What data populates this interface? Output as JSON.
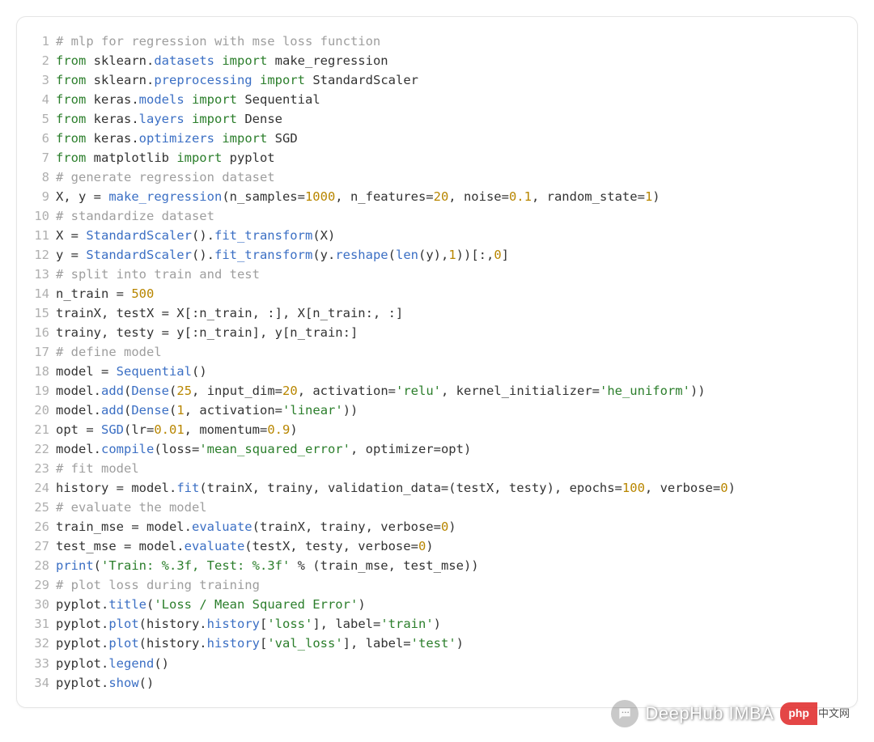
{
  "watermark": {
    "brand": "DeepHub IMBA",
    "badge_left": "php",
    "badge_right": "中文网"
  },
  "code": {
    "lines": [
      [
        {
          "t": "# mlp for regression with mse loss function",
          "c": "comment"
        }
      ],
      [
        {
          "t": "from",
          "c": "keyword"
        },
        {
          "t": " sklearn",
          "c": "ident"
        },
        {
          "t": ".",
          "c": "punct"
        },
        {
          "t": "datasets",
          "c": "func"
        },
        {
          "t": " ",
          "c": "ident"
        },
        {
          "t": "import",
          "c": "keyword"
        },
        {
          "t": " make_regression",
          "c": "ident"
        }
      ],
      [
        {
          "t": "from",
          "c": "keyword"
        },
        {
          "t": " sklearn",
          "c": "ident"
        },
        {
          "t": ".",
          "c": "punct"
        },
        {
          "t": "preprocessing",
          "c": "func"
        },
        {
          "t": " ",
          "c": "ident"
        },
        {
          "t": "import",
          "c": "keyword"
        },
        {
          "t": " StandardScaler",
          "c": "ident"
        }
      ],
      [
        {
          "t": "from",
          "c": "keyword"
        },
        {
          "t": " keras",
          "c": "ident"
        },
        {
          "t": ".",
          "c": "punct"
        },
        {
          "t": "models",
          "c": "func"
        },
        {
          "t": " ",
          "c": "ident"
        },
        {
          "t": "import",
          "c": "keyword"
        },
        {
          "t": " Sequential",
          "c": "ident"
        }
      ],
      [
        {
          "t": "from",
          "c": "keyword"
        },
        {
          "t": " keras",
          "c": "ident"
        },
        {
          "t": ".",
          "c": "punct"
        },
        {
          "t": "layers",
          "c": "func"
        },
        {
          "t": " ",
          "c": "ident"
        },
        {
          "t": "import",
          "c": "keyword"
        },
        {
          "t": " Dense",
          "c": "ident"
        }
      ],
      [
        {
          "t": "from",
          "c": "keyword"
        },
        {
          "t": " keras",
          "c": "ident"
        },
        {
          "t": ".",
          "c": "punct"
        },
        {
          "t": "optimizers",
          "c": "func"
        },
        {
          "t": " ",
          "c": "ident"
        },
        {
          "t": "import",
          "c": "keyword"
        },
        {
          "t": " SGD",
          "c": "ident"
        }
      ],
      [
        {
          "t": "from",
          "c": "keyword"
        },
        {
          "t": " matplotlib ",
          "c": "ident"
        },
        {
          "t": "import",
          "c": "keyword"
        },
        {
          "t": " pyplot",
          "c": "ident"
        }
      ],
      [
        {
          "t": "# generate regression dataset",
          "c": "comment"
        }
      ],
      [
        {
          "t": "X, y = ",
          "c": "ident"
        },
        {
          "t": "make_regression",
          "c": "func"
        },
        {
          "t": "(n_samples=",
          "c": "ident"
        },
        {
          "t": "1000",
          "c": "number"
        },
        {
          "t": ", n_features=",
          "c": "ident"
        },
        {
          "t": "20",
          "c": "number"
        },
        {
          "t": ", noise=",
          "c": "ident"
        },
        {
          "t": "0.1",
          "c": "number"
        },
        {
          "t": ", random_state=",
          "c": "ident"
        },
        {
          "t": "1",
          "c": "number"
        },
        {
          "t": ")",
          "c": "ident"
        }
      ],
      [
        {
          "t": "# standardize dataset",
          "c": "comment"
        }
      ],
      [
        {
          "t": "X = ",
          "c": "ident"
        },
        {
          "t": "StandardScaler",
          "c": "func"
        },
        {
          "t": "().",
          "c": "ident"
        },
        {
          "t": "fit_transform",
          "c": "func"
        },
        {
          "t": "(X)",
          "c": "ident"
        }
      ],
      [
        {
          "t": "y = ",
          "c": "ident"
        },
        {
          "t": "StandardScaler",
          "c": "func"
        },
        {
          "t": "().",
          "c": "ident"
        },
        {
          "t": "fit_transform",
          "c": "func"
        },
        {
          "t": "(y.",
          "c": "ident"
        },
        {
          "t": "reshape",
          "c": "func"
        },
        {
          "t": "(",
          "c": "ident"
        },
        {
          "t": "len",
          "c": "func"
        },
        {
          "t": "(y),",
          "c": "ident"
        },
        {
          "t": "1",
          "c": "number"
        },
        {
          "t": "))[:,",
          "c": "ident"
        },
        {
          "t": "0",
          "c": "number"
        },
        {
          "t": "]",
          "c": "ident"
        }
      ],
      [
        {
          "t": "# split into train and test",
          "c": "comment"
        }
      ],
      [
        {
          "t": "n_train = ",
          "c": "ident"
        },
        {
          "t": "500",
          "c": "number"
        }
      ],
      [
        {
          "t": "trainX, testX = X[:n_train, :], X[n_train:, :]",
          "c": "ident"
        }
      ],
      [
        {
          "t": "trainy, testy = y[:n_train], y[n_train:]",
          "c": "ident"
        }
      ],
      [
        {
          "t": "# define model",
          "c": "comment"
        }
      ],
      [
        {
          "t": "model = ",
          "c": "ident"
        },
        {
          "t": "Sequential",
          "c": "func"
        },
        {
          "t": "()",
          "c": "ident"
        }
      ],
      [
        {
          "t": "model.",
          "c": "ident"
        },
        {
          "t": "add",
          "c": "func"
        },
        {
          "t": "(",
          "c": "ident"
        },
        {
          "t": "Dense",
          "c": "func"
        },
        {
          "t": "(",
          "c": "ident"
        },
        {
          "t": "25",
          "c": "number"
        },
        {
          "t": ", input_dim=",
          "c": "ident"
        },
        {
          "t": "20",
          "c": "number"
        },
        {
          "t": ", activation=",
          "c": "ident"
        },
        {
          "t": "'relu'",
          "c": "string"
        },
        {
          "t": ", kernel_initializer=",
          "c": "ident"
        },
        {
          "t": "'he_uniform'",
          "c": "string"
        },
        {
          "t": "))",
          "c": "ident"
        }
      ],
      [
        {
          "t": "model.",
          "c": "ident"
        },
        {
          "t": "add",
          "c": "func"
        },
        {
          "t": "(",
          "c": "ident"
        },
        {
          "t": "Dense",
          "c": "func"
        },
        {
          "t": "(",
          "c": "ident"
        },
        {
          "t": "1",
          "c": "number"
        },
        {
          "t": ", activation=",
          "c": "ident"
        },
        {
          "t": "'linear'",
          "c": "string"
        },
        {
          "t": "))",
          "c": "ident"
        }
      ],
      [
        {
          "t": "opt = ",
          "c": "ident"
        },
        {
          "t": "SGD",
          "c": "func"
        },
        {
          "t": "(lr=",
          "c": "ident"
        },
        {
          "t": "0.01",
          "c": "number"
        },
        {
          "t": ", momentum=",
          "c": "ident"
        },
        {
          "t": "0.9",
          "c": "number"
        },
        {
          "t": ")",
          "c": "ident"
        }
      ],
      [
        {
          "t": "model.",
          "c": "ident"
        },
        {
          "t": "compile",
          "c": "func"
        },
        {
          "t": "(loss=",
          "c": "ident"
        },
        {
          "t": "'mean_squared_error'",
          "c": "string"
        },
        {
          "t": ", optimizer=opt)",
          "c": "ident"
        }
      ],
      [
        {
          "t": "# fit model",
          "c": "comment"
        }
      ],
      [
        {
          "t": "history = model.",
          "c": "ident"
        },
        {
          "t": "fit",
          "c": "func"
        },
        {
          "t": "(trainX, trainy, validation_data=(testX, testy), epochs=",
          "c": "ident"
        },
        {
          "t": "100",
          "c": "number"
        },
        {
          "t": ", verbose=",
          "c": "ident"
        },
        {
          "t": "0",
          "c": "number"
        },
        {
          "t": ")",
          "c": "ident"
        }
      ],
      [
        {
          "t": "# evaluate the model",
          "c": "comment"
        }
      ],
      [
        {
          "t": "train_mse = model.",
          "c": "ident"
        },
        {
          "t": "evaluate",
          "c": "func"
        },
        {
          "t": "(trainX, trainy, verbose=",
          "c": "ident"
        },
        {
          "t": "0",
          "c": "number"
        },
        {
          "t": ")",
          "c": "ident"
        }
      ],
      [
        {
          "t": "test_mse = model.",
          "c": "ident"
        },
        {
          "t": "evaluate",
          "c": "func"
        },
        {
          "t": "(testX, testy, verbose=",
          "c": "ident"
        },
        {
          "t": "0",
          "c": "number"
        },
        {
          "t": ")",
          "c": "ident"
        }
      ],
      [
        {
          "t": "print",
          "c": "func"
        },
        {
          "t": "(",
          "c": "ident"
        },
        {
          "t": "'Train: %.3f, Test: %.3f'",
          "c": "string"
        },
        {
          "t": " % (train_mse, test_mse))",
          "c": "ident"
        }
      ],
      [
        {
          "t": "# plot loss during training",
          "c": "comment"
        }
      ],
      [
        {
          "t": "pyplot.",
          "c": "ident"
        },
        {
          "t": "title",
          "c": "func"
        },
        {
          "t": "(",
          "c": "ident"
        },
        {
          "t": "'Loss / Mean Squared Error'",
          "c": "string"
        },
        {
          "t": ")",
          "c": "ident"
        }
      ],
      [
        {
          "t": "pyplot.",
          "c": "ident"
        },
        {
          "t": "plot",
          "c": "func"
        },
        {
          "t": "(history.",
          "c": "ident"
        },
        {
          "t": "history",
          "c": "func"
        },
        {
          "t": "[",
          "c": "ident"
        },
        {
          "t": "'loss'",
          "c": "string"
        },
        {
          "t": "], label=",
          "c": "ident"
        },
        {
          "t": "'train'",
          "c": "string"
        },
        {
          "t": ")",
          "c": "ident"
        }
      ],
      [
        {
          "t": "pyplot.",
          "c": "ident"
        },
        {
          "t": "plot",
          "c": "func"
        },
        {
          "t": "(history.",
          "c": "ident"
        },
        {
          "t": "history",
          "c": "func"
        },
        {
          "t": "[",
          "c": "ident"
        },
        {
          "t": "'val_loss'",
          "c": "string"
        },
        {
          "t": "], label=",
          "c": "ident"
        },
        {
          "t": "'test'",
          "c": "string"
        },
        {
          "t": ")",
          "c": "ident"
        }
      ],
      [
        {
          "t": "pyplot.",
          "c": "ident"
        },
        {
          "t": "legend",
          "c": "func"
        },
        {
          "t": "()",
          "c": "ident"
        }
      ],
      [
        {
          "t": "pyplot.",
          "c": "ident"
        },
        {
          "t": "show",
          "c": "func"
        },
        {
          "t": "()",
          "c": "ident"
        }
      ]
    ]
  }
}
